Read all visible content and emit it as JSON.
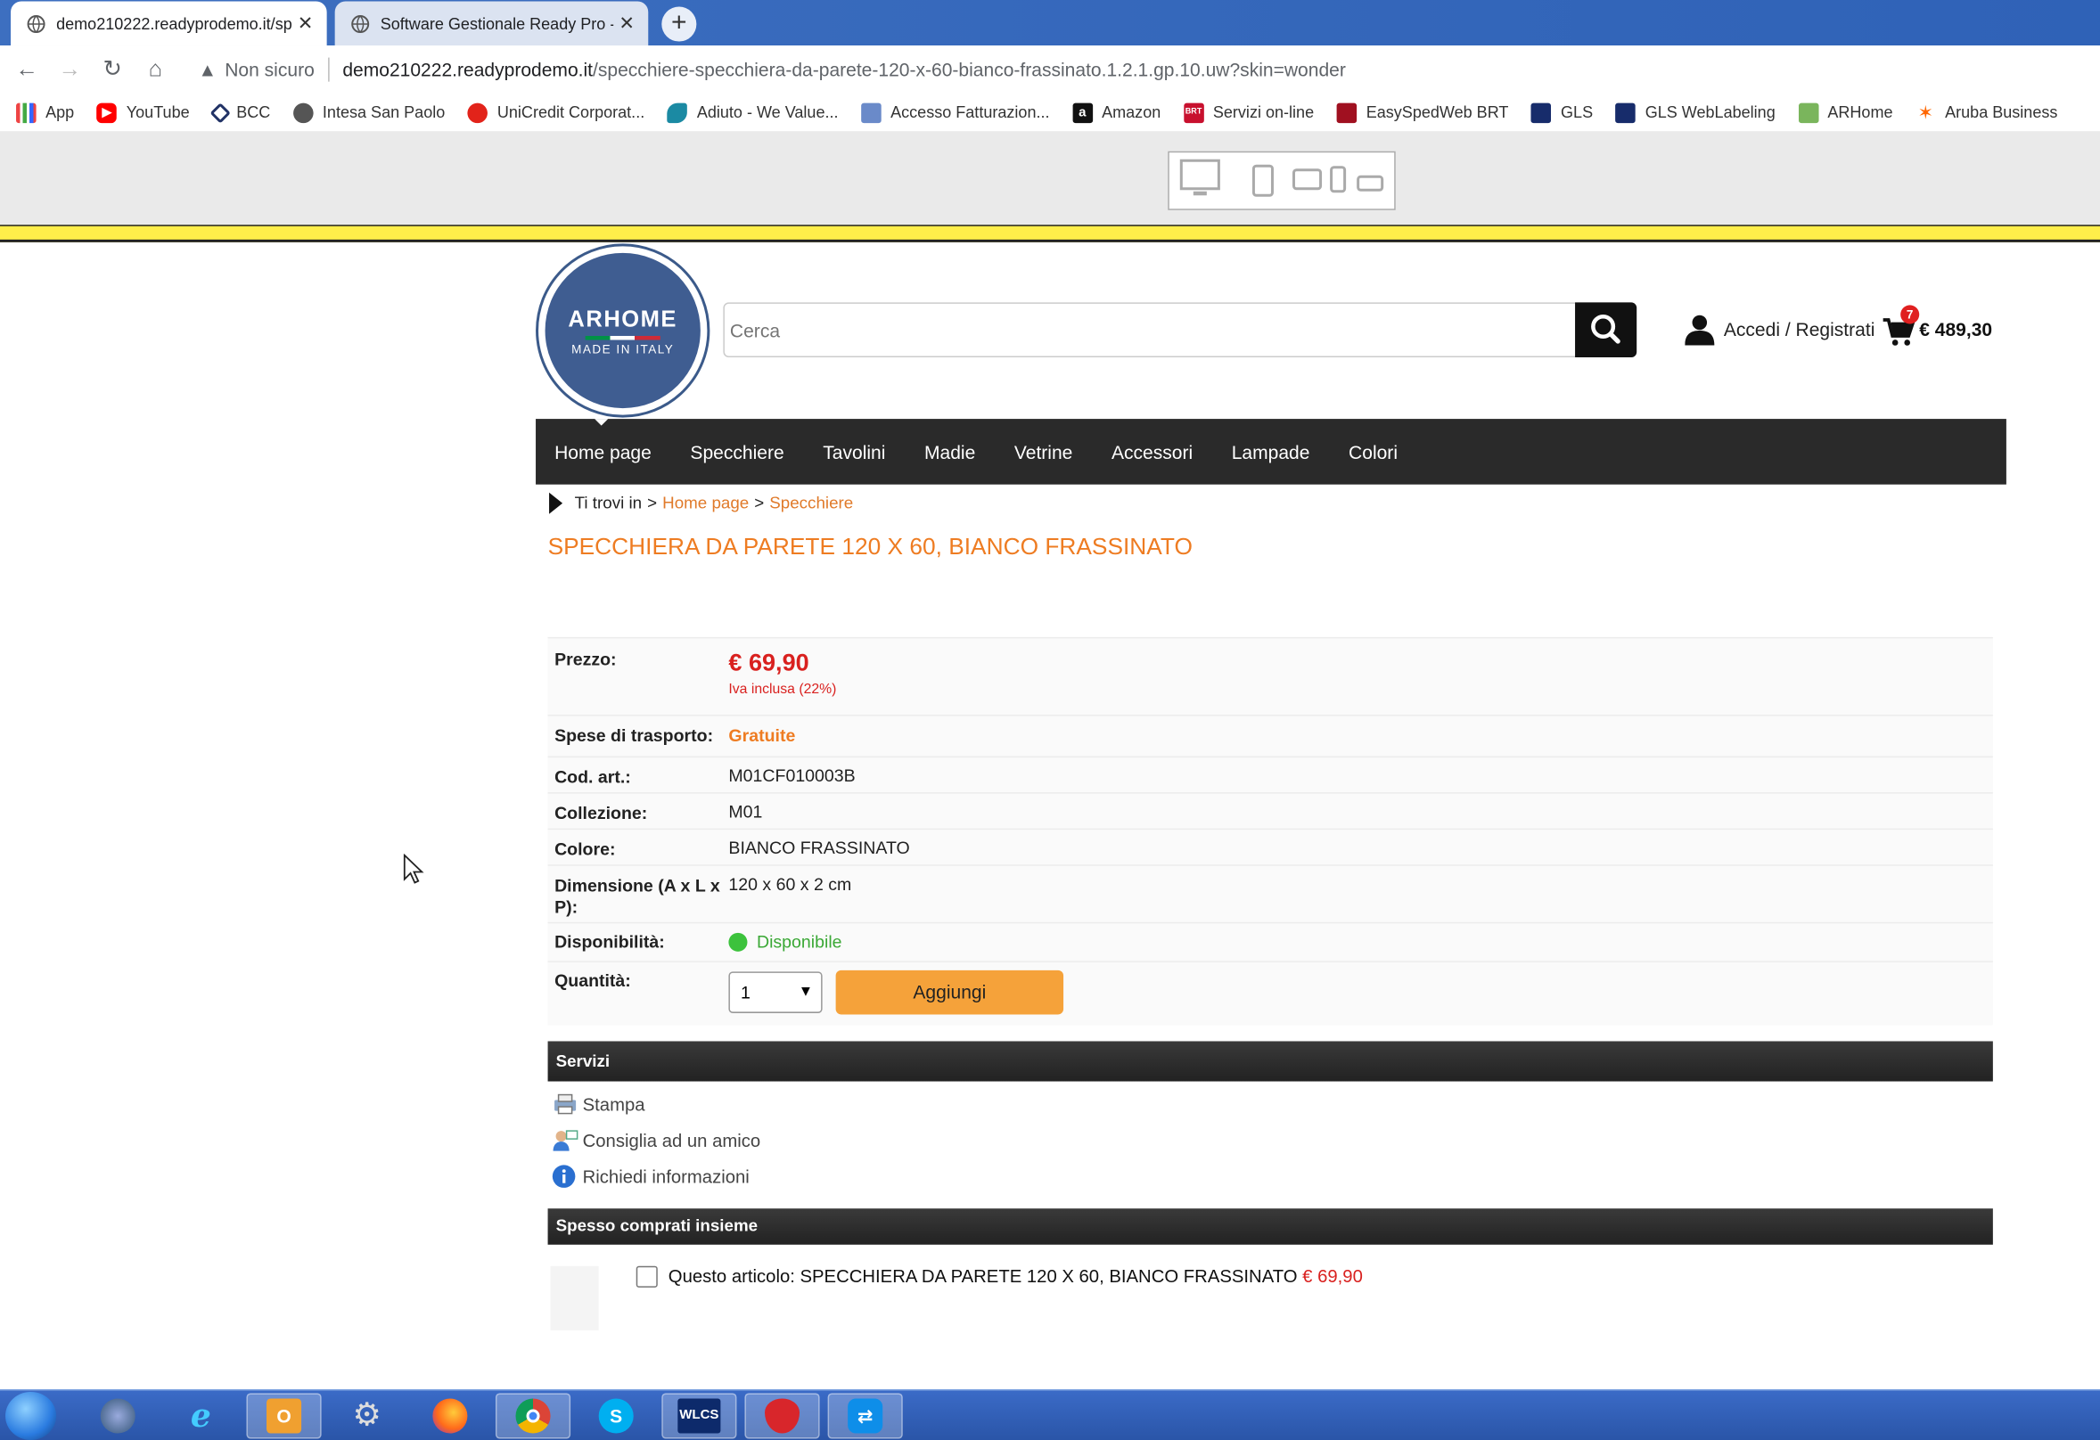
{
  "browser": {
    "tabs": [
      {
        "title": "demo210222.readyprodemo.it/sp",
        "active": true
      },
      {
        "title": "Software Gestionale Ready Pro -",
        "active": false
      }
    ],
    "security_label": "Non sicuro",
    "url_host": "demo210222.readyprodemo.it",
    "url_path": "/specchiere-specchiera-da-parete-120-x-60-bianco-frassinato.1.2.1.gp.10.uw?skin=wonder",
    "bookmarks": [
      {
        "label": "App",
        "icon": "apps-grid-icon"
      },
      {
        "label": "YouTube",
        "icon": "youtube-icon"
      },
      {
        "label": "BCC",
        "icon": "bcc-icon"
      },
      {
        "label": "Intesa San Paolo",
        "icon": "globe-icon"
      },
      {
        "label": "UniCredit Corporat...",
        "icon": "unicredit-icon"
      },
      {
        "label": "Adiuto - We Value...",
        "icon": "adiuto-icon"
      },
      {
        "label": "Accesso Fatturazion...",
        "icon": "building-icon"
      },
      {
        "label": "Amazon",
        "icon": "amazon-icon"
      },
      {
        "label": "Servizi on-line",
        "icon": "brt-icon"
      },
      {
        "label": "EasySpedWeb BRT",
        "icon": "truck-icon"
      },
      {
        "label": "GLS",
        "icon": "gls-icon"
      },
      {
        "label": "GLS WebLabeling",
        "icon": "gls-icon"
      },
      {
        "label": "ARHome",
        "icon": "shopify-icon"
      },
      {
        "label": "Aruba Business",
        "icon": "aruba-icon"
      }
    ]
  },
  "site": {
    "logo_brand": "ARHOME",
    "logo_tagline": "MADE IN ITALY",
    "search_placeholder": "Cerca",
    "account_label": "Accedi / Registrati",
    "cart_count": "7",
    "cart_total": "€ 489,30",
    "nav": [
      "Home page",
      "Specchiere",
      "Tavolini",
      "Madie",
      "Vetrine",
      "Accessori",
      "Lampade",
      "Colori"
    ]
  },
  "breadcrumb": {
    "prefix": "Ti trovi in",
    "items": [
      "Home page",
      "Specchiere"
    ]
  },
  "product": {
    "title": "SPECCHIERA DA PARETE 120 X 60, BIANCO FRASSINATO",
    "price_label": "Prezzo:",
    "price": "€ 69,90",
    "vat_note": "Iva inclusa (22%)",
    "shipping_label": "Spese di trasporto:",
    "shipping_value": "Gratuite",
    "code_label": "Cod. art.:",
    "code_value": "M01CF010003B",
    "collection_label": "Collezione:",
    "collection_value": "M01",
    "color_label": "Colore:",
    "color_value": "BIANCO FRASSINATO",
    "dimension_label": "Dimensione (A x L x P):",
    "dimension_value": "120 x 60 x 2 cm",
    "availability_label": "Disponibilità:",
    "availability_value": "Disponibile",
    "quantity_label": "Quantità:",
    "quantity_value": "1",
    "add_button": "Aggiungi"
  },
  "services": {
    "heading": "Servizi",
    "items": [
      "Stampa",
      "Consiglia ad un amico",
      "Richiedi informazioni"
    ]
  },
  "bought_together": {
    "heading": "Spesso comprati insieme",
    "item_text": "Questo articolo: SPECCHIERA DA PARETE 120 X 60, BIANCO FRASSINATO",
    "item_price": "€ 69,90"
  },
  "taskbar": {
    "apps": [
      "start-orb",
      "network-icon",
      "internet-explorer-icon",
      "outlook-icon",
      "settings-icon",
      "firefox-icon",
      "chrome-icon",
      "skype-icon",
      "wlcs-icon",
      "strawberry-icon",
      "teamviewer-icon"
    ],
    "wlcs_label": "WLCS"
  },
  "colors": {
    "accent_orange": "#ee7c22",
    "price_red": "#d9211f",
    "nav_dark": "#2a2a2a",
    "logo_blue": "#3f5d91"
  }
}
